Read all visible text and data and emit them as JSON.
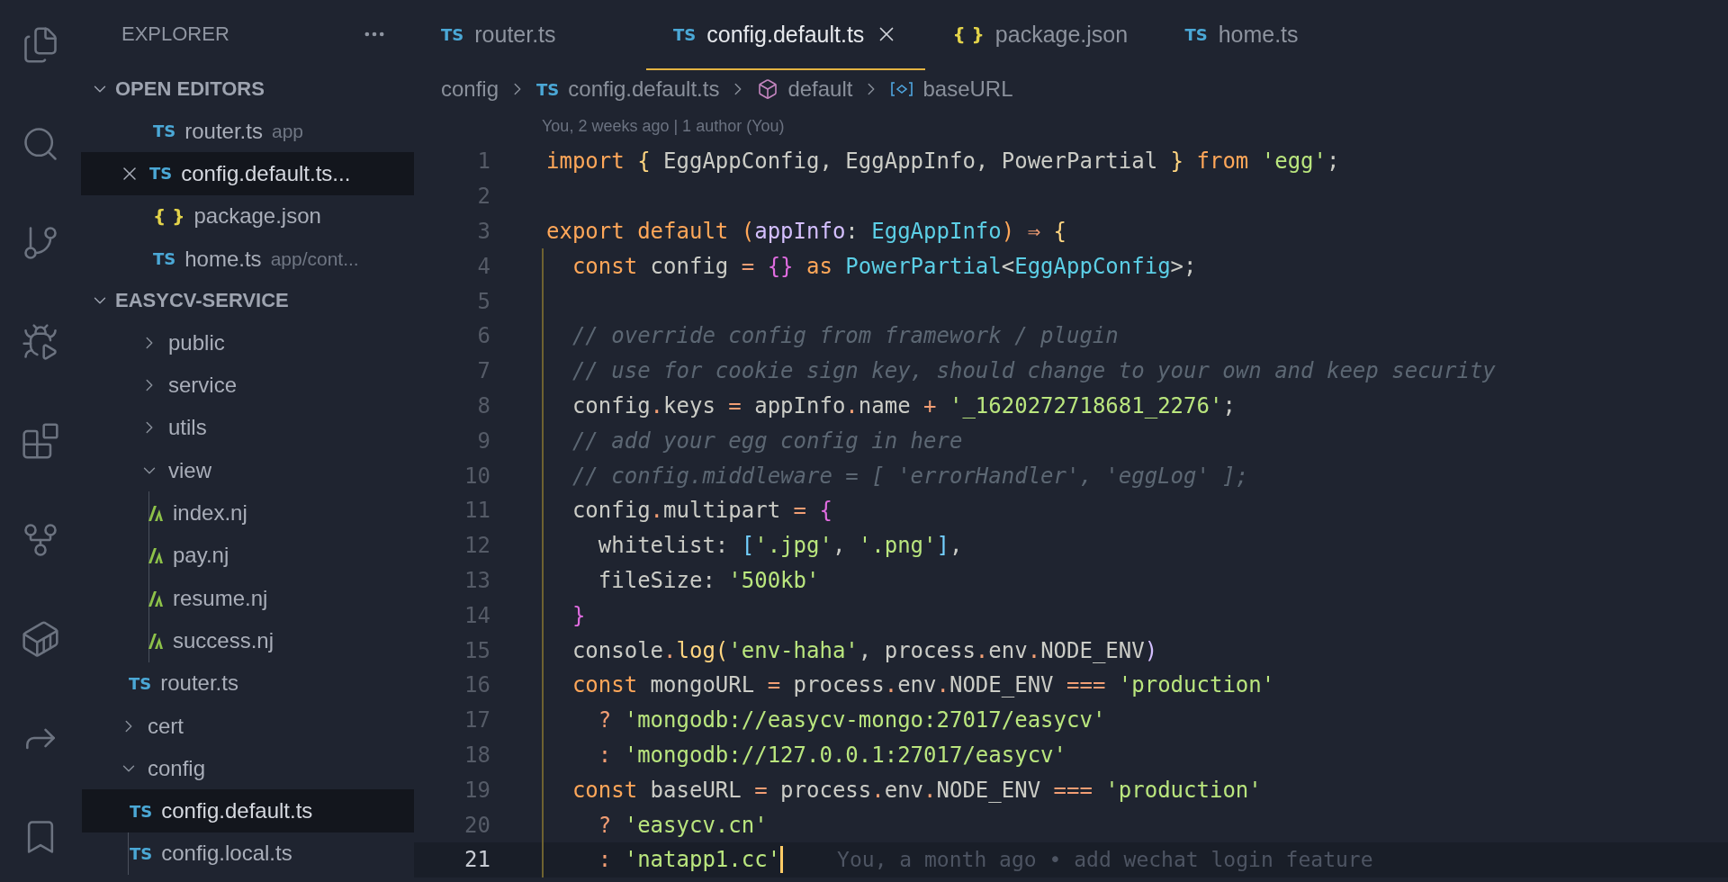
{
  "explorer": {
    "title": "EXPLORER",
    "open_editors": {
      "title": "OPEN EDITORS",
      "expanded": true,
      "items": [
        {
          "kind": "ts",
          "icon_text": "TS",
          "name": "router.ts",
          "description": "app",
          "selected": false
        },
        {
          "kind": "ts",
          "icon_text": "TS",
          "name": "config.default.ts...",
          "selected": true
        },
        {
          "kind": "json",
          "icon_text": "{ }",
          "name": "package.json",
          "selected": false
        },
        {
          "kind": "ts",
          "icon_text": "TS",
          "name": "home.ts",
          "description": "app/cont...",
          "selected": false
        }
      ]
    },
    "project": {
      "title": "EASYCV-SERVICE",
      "expanded": true,
      "tree": [
        {
          "kind": "folder",
          "children": [
            {
              "kind": "folder",
              "name": "public",
              "expanded": false,
              "selected": false
            },
            {
              "kind": "folder",
              "name": "service",
              "expanded": false,
              "selected": false
            },
            {
              "kind": "folder",
              "name": "utils",
              "expanded": false,
              "selected": false
            },
            {
              "kind": "folder",
              "name": "view",
              "expanded": true,
              "selected": false,
              "children": [
                {
                  "kind": "nj",
                  "name": "index.nj",
                  "selected": false
                },
                {
                  "kind": "nj",
                  "name": "pay.nj",
                  "selected": false
                },
                {
                  "kind": "nj",
                  "name": "resume.nj",
                  "selected": false
                },
                {
                  "kind": "nj",
                  "name": "success.nj",
                  "selected": false
                }
              ]
            },
            {
              "kind": "ts",
              "icon_text": "TS",
              "name": "router.ts",
              "selected": false
            }
          ]
        },
        {
          "kind": "folder",
          "name": "cert",
          "expanded": false,
          "selected": false
        },
        {
          "kind": "folder",
          "name": "config",
          "expanded": true,
          "selected": false,
          "children": [
            {
              "kind": "ts",
              "icon_text": "TS",
              "name": "config.default.ts",
              "selected": true
            },
            {
              "kind": "ts",
              "icon_text": "TS",
              "name": "config.local.ts",
              "selected": false
            }
          ]
        }
      ]
    }
  },
  "tabs": [
    {
      "kind": "ts",
      "icon_text": "TS",
      "label": "router.ts",
      "selected": false
    },
    {
      "kind": "ts",
      "icon_text": "TS",
      "label": "config.default.ts",
      "selected": true
    },
    {
      "kind": "json",
      "icon_text": "{ }",
      "label": "package.json",
      "selected": false
    },
    {
      "kind": "ts",
      "icon_text": "TS",
      "label": "home.ts",
      "selected": false
    }
  ],
  "breadcrumbs": [
    {
      "kind": "folder",
      "label": "config"
    },
    {
      "kind": "ts",
      "icon_text": "TS",
      "label": "config.default.ts"
    },
    {
      "kind": "module",
      "label": "default"
    },
    {
      "kind": "variable",
      "label": "baseURL"
    }
  ],
  "codelens": "You, 2 weeks ago | 1 author (You)",
  "lines": [
    {
      "number": "1",
      "scoped": false,
      "tokens": [
        {
          "text": "import ",
          "kind": "kw"
        },
        {
          "text": "{",
          "kind": "brace"
        },
        {
          "text": " EggAppConfig, EggAppInfo, PowerPartial ",
          "kind": "plain"
        },
        {
          "text": "}",
          "kind": "brace"
        },
        {
          "text": " from ",
          "kind": "kw"
        },
        {
          "text": "'egg'",
          "kind": "str"
        },
        {
          "text": ";",
          "kind": "plain"
        }
      ]
    },
    {
      "number": "2"
    },
    {
      "number": "3",
      "scoped": false,
      "tokens": [
        {
          "text": "export default (",
          "kind": "kw"
        },
        {
          "text": "appInfo",
          "kind": "param"
        },
        {
          "text": ": ",
          "kind": "plain"
        },
        {
          "text": "EggAppInfo",
          "kind": "type"
        },
        {
          "text": ")",
          "kind": "kw"
        },
        {
          "text": " ⇒ ",
          "kind": "op"
        },
        {
          "text": "{",
          "kind": "brace"
        }
      ]
    },
    {
      "number": "4",
      "scoped": true,
      "tokens": [
        {
          "text": "  const",
          "kind": "kw"
        },
        {
          "text": " config ",
          "kind": "plain"
        },
        {
          "text": "= ",
          "kind": "op"
        },
        {
          "text": "{}",
          "kind": "brace2"
        },
        {
          "text": " as ",
          "kind": "kw"
        },
        {
          "text": "PowerPartial",
          "kind": "type"
        },
        {
          "text": "<",
          "kind": "plain"
        },
        {
          "text": "EggAppConfig",
          "kind": "type"
        },
        {
          "text": ">;",
          "kind": "plain"
        }
      ]
    },
    {
      "number": "5",
      "scoped": true
    },
    {
      "number": "6",
      "scoped": true,
      "tokens": [
        {
          "text": "  // override config from framework / plugin",
          "kind": "comment"
        }
      ]
    },
    {
      "number": "7",
      "scoped": true,
      "tokens": [
        {
          "text": "  // use for cookie sign key, should change to your own and keep security",
          "kind": "comment"
        }
      ]
    },
    {
      "number": "8",
      "scoped": true,
      "tokens": [
        {
          "text": "  config",
          "kind": "plain"
        },
        {
          "text": ".",
          "kind": "op"
        },
        {
          "text": "keys ",
          "kind": "plain"
        },
        {
          "text": "=",
          "kind": "op"
        },
        {
          "text": " appInfo",
          "kind": "plain"
        },
        {
          "text": ".",
          "kind": "op"
        },
        {
          "text": "name ",
          "kind": "plain"
        },
        {
          "text": "+ ",
          "kind": "op"
        },
        {
          "text": "'_1620272718681_2276'",
          "kind": "str"
        },
        {
          "text": ";",
          "kind": "plain"
        }
      ]
    },
    {
      "number": "9",
      "scoped": true,
      "tokens": [
        {
          "text": "  // add your egg config in here",
          "kind": "comment"
        }
      ]
    },
    {
      "number": "10",
      "scoped": true,
      "tokens": [
        {
          "text": "  // config.middleware = [ 'errorHandler', 'eggLog' ];",
          "kind": "comment"
        }
      ]
    },
    {
      "number": "11",
      "scoped": true,
      "tokens": [
        {
          "text": "  config",
          "kind": "plain"
        },
        {
          "text": ".",
          "kind": "op"
        },
        {
          "text": "multipart ",
          "kind": "plain"
        },
        {
          "text": "= ",
          "kind": "op"
        },
        {
          "text": "{",
          "kind": "brace2"
        }
      ]
    },
    {
      "number": "12",
      "scoped": true,
      "tokens": [
        {
          "text": "    whitelist: ",
          "kind": "plain"
        },
        {
          "text": "[",
          "kind": "bracket"
        },
        {
          "text": "'.jpg'",
          "kind": "str"
        },
        {
          "text": ", ",
          "kind": "plain"
        },
        {
          "text": "'.png'",
          "kind": "str"
        },
        {
          "text": "]",
          "kind": "bracket"
        },
        {
          "text": ",",
          "kind": "plain"
        }
      ]
    },
    {
      "number": "13",
      "scoped": true,
      "tokens": [
        {
          "text": "    fileSize: ",
          "kind": "plain"
        },
        {
          "text": "'500kb'",
          "kind": "str"
        }
      ]
    },
    {
      "number": "14",
      "scoped": true,
      "tokens": [
        {
          "text": "  }",
          "kind": "brace2"
        }
      ]
    },
    {
      "number": "15",
      "scoped": true,
      "tokens": [
        {
          "text": "  console",
          "kind": "plain"
        },
        {
          "text": ".",
          "kind": "op"
        },
        {
          "text": "log",
          "kind": "func"
        },
        {
          "text": "(",
          "kind": "brace"
        },
        {
          "text": "'env-haha'",
          "kind": "str"
        },
        {
          "text": ", process",
          "kind": "plain"
        },
        {
          "text": ".",
          "kind": "op"
        },
        {
          "text": "env",
          "kind": "plain"
        },
        {
          "text": ".",
          "kind": "op"
        },
        {
          "text": "NODE_ENV",
          "kind": "plain"
        },
        {
          "text": ")",
          "kind": "param"
        }
      ]
    },
    {
      "number": "16",
      "scoped": true,
      "tokens": [
        {
          "text": "  const",
          "kind": "kw"
        },
        {
          "text": " mongoURL ",
          "kind": "plain"
        },
        {
          "text": "=",
          "kind": "op"
        },
        {
          "text": " process",
          "kind": "plain"
        },
        {
          "text": ".",
          "kind": "op"
        },
        {
          "text": "env",
          "kind": "plain"
        },
        {
          "text": ".",
          "kind": "op"
        },
        {
          "text": "NODE_ENV ",
          "kind": "plain"
        },
        {
          "text": "=== ",
          "kind": "op"
        },
        {
          "text": "'production'",
          "kind": "str"
        }
      ]
    },
    {
      "number": "17",
      "scoped": true,
      "tokens": [
        {
          "text": "    ? ",
          "kind": "op"
        },
        {
          "text": "'mongodb://easycv-mongo:27017/easycv'",
          "kind": "str"
        }
      ]
    },
    {
      "number": "18",
      "scoped": true,
      "tokens": [
        {
          "text": "    : ",
          "kind": "op"
        },
        {
          "text": "'mongodb://127.0.0.1:27017/easycv'",
          "kind": "str"
        }
      ]
    },
    {
      "number": "19",
      "scoped": true,
      "tokens": [
        {
          "text": "  const",
          "kind": "kw"
        },
        {
          "text": " baseURL ",
          "kind": "plain"
        },
        {
          "text": "=",
          "kind": "op"
        },
        {
          "text": " process",
          "kind": "plain"
        },
        {
          "text": ".",
          "kind": "op"
        },
        {
          "text": "env",
          "kind": "plain"
        },
        {
          "text": ".",
          "kind": "op"
        },
        {
          "text": "NODE_ENV ",
          "kind": "plain"
        },
        {
          "text": "=== ",
          "kind": "op"
        },
        {
          "text": "'production'",
          "kind": "str"
        }
      ]
    },
    {
      "number": "20",
      "scoped": true,
      "tokens": [
        {
          "text": "    ? ",
          "kind": "op"
        },
        {
          "text": "'easycv.cn'",
          "kind": "str"
        }
      ]
    },
    {
      "number": "21",
      "scoped": true,
      "cursor": true,
      "blame": "You, a month ago • add wechat login feature",
      "tokens": [
        {
          "text": "    : ",
          "kind": "op"
        },
        {
          "text": "'natapp1.cc'",
          "kind": "str"
        }
      ]
    }
  ]
}
